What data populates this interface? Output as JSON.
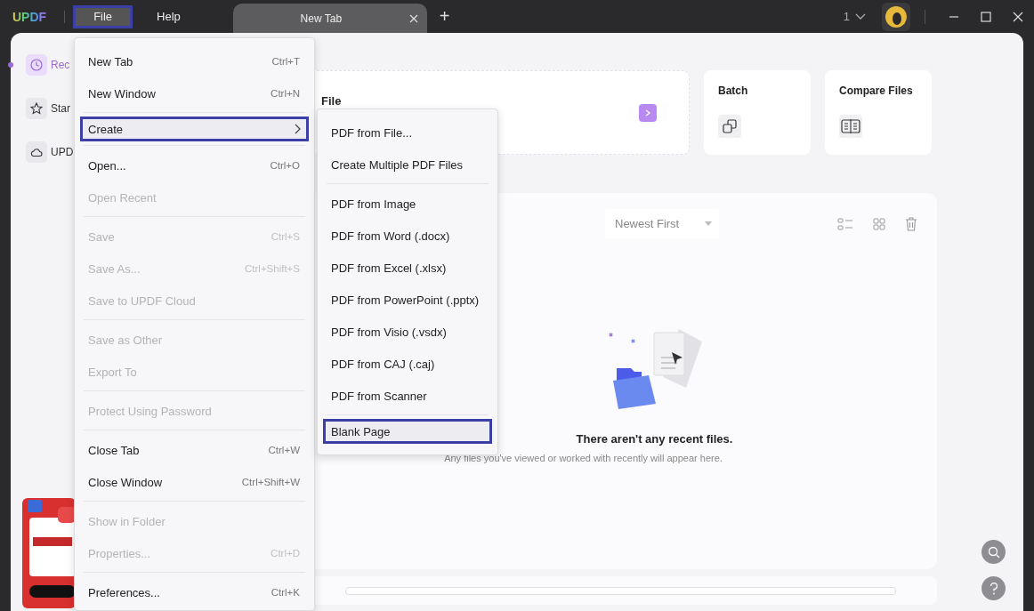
{
  "titlebar": {
    "logo": "UPDF",
    "menus": [
      {
        "label": "File",
        "selected": true
      },
      {
        "label": "Help",
        "selected": false
      }
    ],
    "tab": {
      "label": "New Tab"
    },
    "new_tab": "+",
    "page_count": "1"
  },
  "sidebar": {
    "items": [
      {
        "label": "Rec",
        "selected": true
      },
      {
        "label": "Star",
        "selected": false
      },
      {
        "label": "UPD",
        "selected": false
      }
    ]
  },
  "tools": [
    {
      "kind": "wide",
      "label": "File"
    },
    {
      "kind": "batch",
      "label": "Batch"
    },
    {
      "kind": "compare",
      "label": "Compare Files"
    }
  ],
  "recent": {
    "sort": "Newest First",
    "empty_title": "There aren't any recent files.",
    "empty_hint": "Any files you've viewed or worked with recently will appear here."
  },
  "file_menu": {
    "items": [
      {
        "kind": "item",
        "label": "New Tab",
        "shortcut": "Ctrl+T",
        "disabled": false,
        "selected": false,
        "submenu": false
      },
      {
        "kind": "item",
        "label": "New Window",
        "shortcut": "Ctrl+N",
        "disabled": false,
        "selected": false,
        "submenu": false
      },
      {
        "kind": "separator"
      },
      {
        "kind": "item",
        "label": "Create",
        "disabled": false,
        "selected": true,
        "submenu": true
      },
      {
        "kind": "separator"
      },
      {
        "kind": "item",
        "label": "Open...",
        "shortcut": "Ctrl+O",
        "disabled": false,
        "selected": false,
        "submenu": false
      },
      {
        "kind": "item",
        "label": "Open Recent",
        "disabled": true,
        "selected": false,
        "submenu": false
      },
      {
        "kind": "separator"
      },
      {
        "kind": "item",
        "label": "Save",
        "shortcut": "Ctrl+S",
        "disabled": true,
        "selected": false,
        "submenu": false
      },
      {
        "kind": "item",
        "label": "Save As...",
        "shortcut": "Ctrl+Shift+S",
        "disabled": true,
        "selected": false,
        "submenu": false
      },
      {
        "kind": "item",
        "label": "Save to UPDF Cloud",
        "disabled": true,
        "selected": false,
        "submenu": false
      },
      {
        "kind": "separator"
      },
      {
        "kind": "item",
        "label": "Save as Other",
        "disabled": true,
        "selected": false,
        "submenu": false
      },
      {
        "kind": "item",
        "label": "Export To",
        "disabled": true,
        "selected": false,
        "submenu": false
      },
      {
        "kind": "separator"
      },
      {
        "kind": "item",
        "label": "Protect Using Password",
        "disabled": true,
        "selected": false,
        "submenu": false
      },
      {
        "kind": "separator"
      },
      {
        "kind": "item",
        "label": "Close Tab",
        "shortcut": "Ctrl+W",
        "disabled": false,
        "selected": false,
        "submenu": false
      },
      {
        "kind": "item",
        "label": "Close Window",
        "shortcut": "Ctrl+Shift+W",
        "disabled": false,
        "selected": false,
        "submenu": false
      },
      {
        "kind": "separator"
      },
      {
        "kind": "item",
        "label": "Show in Folder",
        "disabled": true,
        "selected": false,
        "submenu": false
      },
      {
        "kind": "item",
        "label": "Properties...",
        "shortcut": "Ctrl+D",
        "disabled": true,
        "selected": false,
        "submenu": false
      },
      {
        "kind": "separator"
      },
      {
        "kind": "item",
        "label": "Preferences...",
        "shortcut": "Ctrl+K",
        "disabled": false,
        "selected": false,
        "submenu": false
      }
    ]
  },
  "create_menu": {
    "items": [
      {
        "kind": "item",
        "label": "PDF from File...",
        "disabled": false,
        "selected": false,
        "submenu": false
      },
      {
        "kind": "item",
        "label": "Create Multiple PDF Files",
        "disabled": false,
        "selected": false,
        "submenu": false
      },
      {
        "kind": "separator"
      },
      {
        "kind": "item",
        "label": "PDF from Image",
        "disabled": false,
        "selected": false,
        "submenu": false
      },
      {
        "kind": "item",
        "label": "PDF from Word (.docx)",
        "disabled": false,
        "selected": false,
        "submenu": false
      },
      {
        "kind": "item",
        "label": "PDF from Excel (.xlsx)",
        "disabled": false,
        "selected": false,
        "submenu": false
      },
      {
        "kind": "item",
        "label": "PDF from PowerPoint (.pptx)",
        "disabled": false,
        "selected": false,
        "submenu": false
      },
      {
        "kind": "item",
        "label": "PDF from Visio (.vsdx)",
        "disabled": false,
        "selected": false,
        "submenu": false
      },
      {
        "kind": "item",
        "label": "PDF from CAJ (.caj)",
        "disabled": false,
        "selected": false,
        "submenu": false
      },
      {
        "kind": "item",
        "label": "PDF from Scanner",
        "disabled": false,
        "selected": false,
        "submenu": false
      },
      {
        "kind": "separator"
      },
      {
        "kind": "item",
        "label": "Blank Page",
        "disabled": false,
        "selected": true,
        "submenu": false
      }
    ]
  }
}
